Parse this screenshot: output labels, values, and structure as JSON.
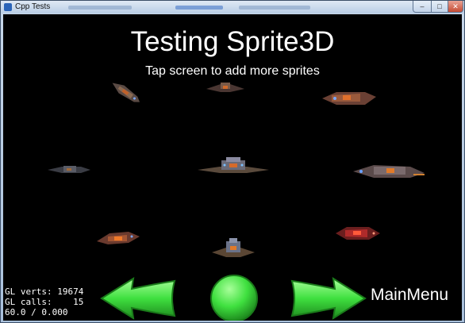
{
  "window": {
    "title": "Cpp Tests",
    "minimize_glyph": "–",
    "maximize_glyph": "□",
    "close_glyph": "✕"
  },
  "scene": {
    "title": "Testing Sprite3D",
    "subtitle": "Tap screen to add more sprites",
    "sprite_count": 9
  },
  "stats": {
    "line1": "GL verts: 19674",
    "line2": "GL calls:    15",
    "line3": "60.0 / 0.000"
  },
  "controls": {
    "back_icon": "left-arrow-icon",
    "restart_icon": "green-circle-icon",
    "next_icon": "right-arrow-icon",
    "main_menu_label": "MainMenu",
    "accent": "#3fe03f"
  }
}
